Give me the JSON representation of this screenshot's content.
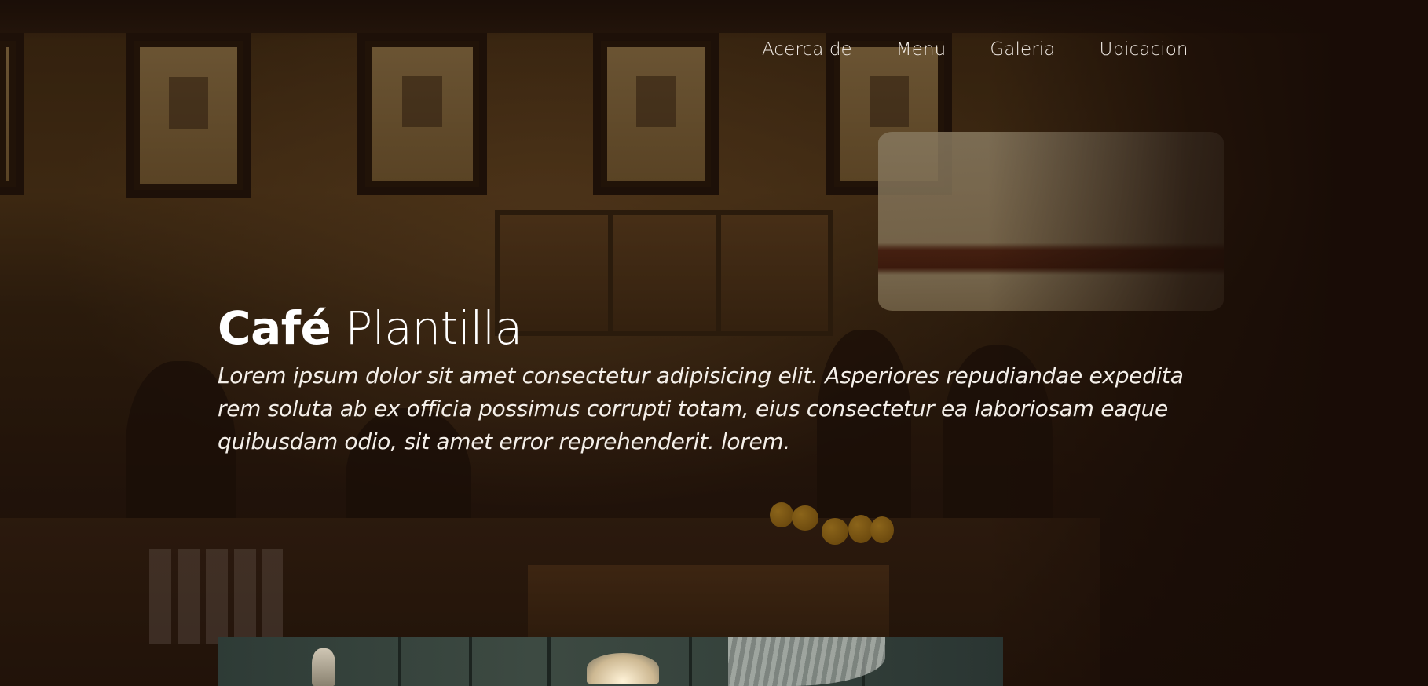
{
  "nav": {
    "items": [
      {
        "label": "Acerca de"
      },
      {
        "label": "Menu"
      },
      {
        "label": "Galeria"
      },
      {
        "label": "Ubicacion"
      }
    ]
  },
  "hero": {
    "title_strong": "Café",
    "title_light": "Plantilla",
    "description": "Lorem ipsum dolor sit amet consectetur adipisicing elit. Asperiores repudiandae expedita rem soluta ab ex officia possimus corrupti totam, eius consectetur ea laboriosam eaque quibusdam odio, sit amet error reprehenderit. lorem."
  },
  "colors": {
    "overlay": "#160a04",
    "text": "#ffffff",
    "background": "#1c0f08"
  }
}
